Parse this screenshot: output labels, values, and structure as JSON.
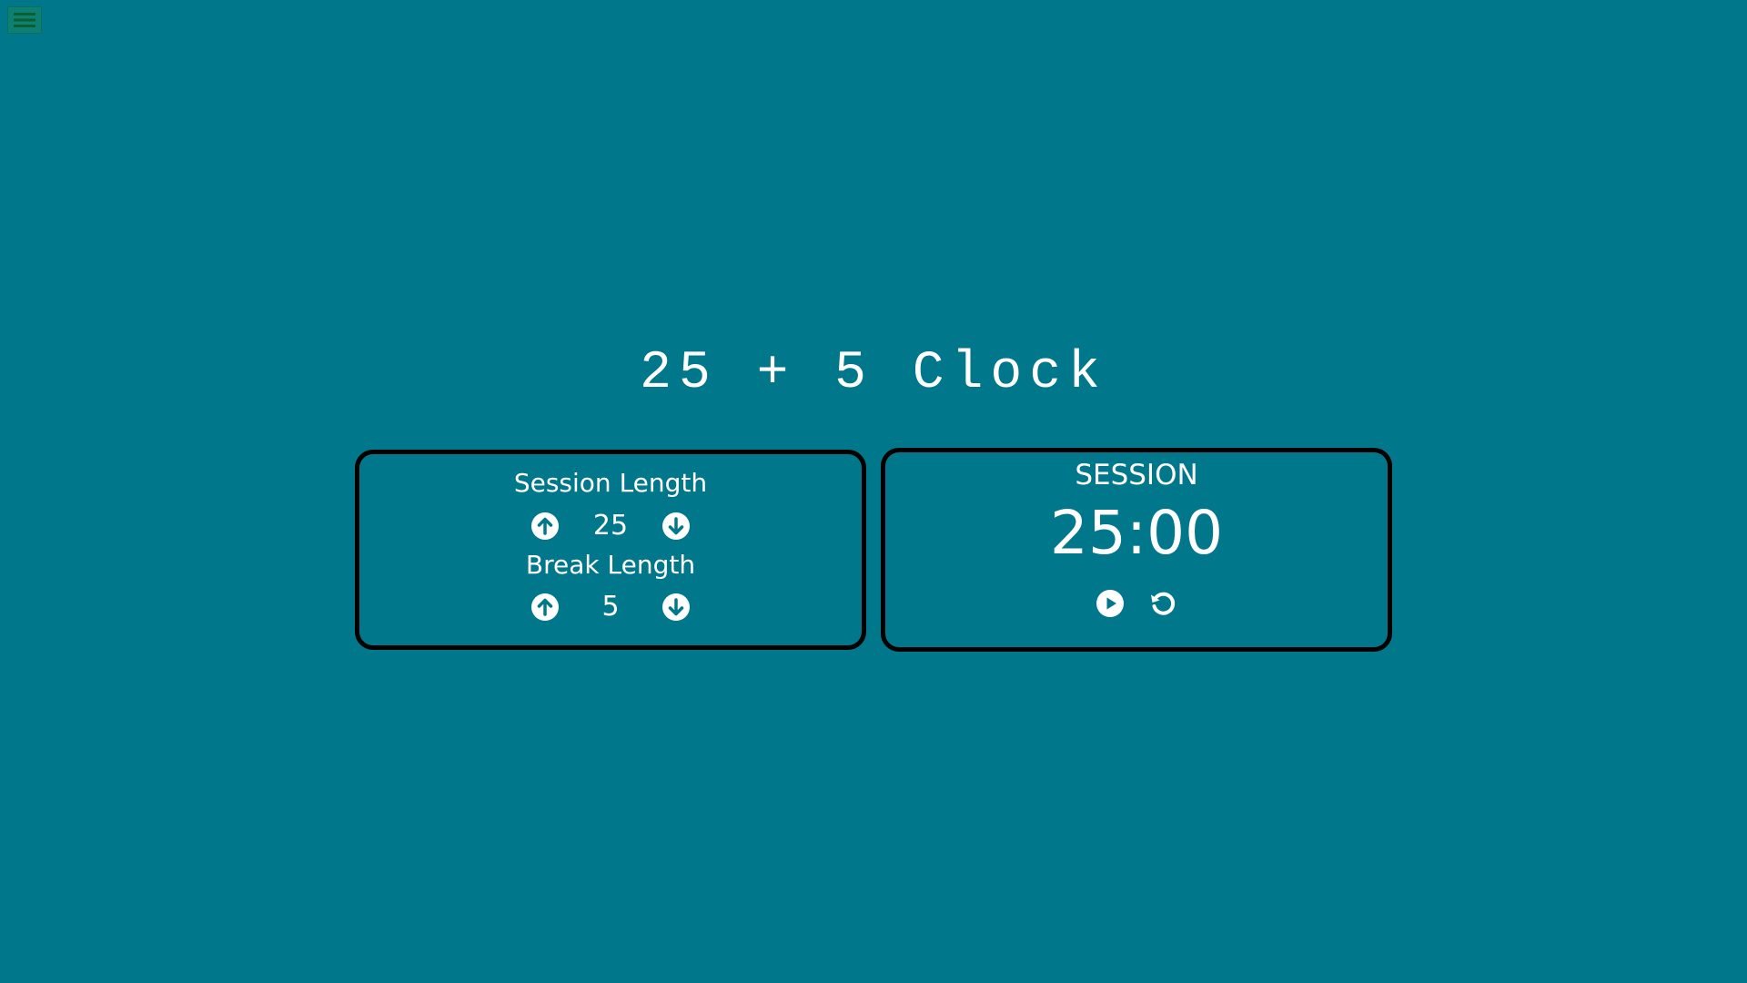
{
  "app": {
    "title": "25 + 5 Clock"
  },
  "menu": {
    "icon": "hamburger-menu-icon"
  },
  "settings": {
    "session": {
      "label": "Session Length",
      "value": "25",
      "increment_icon": "arrow-up-circle-icon",
      "decrement_icon": "arrow-down-circle-icon"
    },
    "break": {
      "label": "Break Length",
      "value": "5",
      "increment_icon": "arrow-up-circle-icon",
      "decrement_icon": "arrow-down-circle-icon"
    }
  },
  "timer": {
    "label": "SESSION",
    "time_left": "25:00",
    "start_stop_icon": "play-circle-icon",
    "reset_icon": "reset-icon"
  },
  "colors": {
    "background": "#00778A",
    "panel_border": "#000000",
    "text": "#FFFFFF",
    "menu_button": "#0E7F73",
    "menu_icon": "#0B5E2E"
  }
}
